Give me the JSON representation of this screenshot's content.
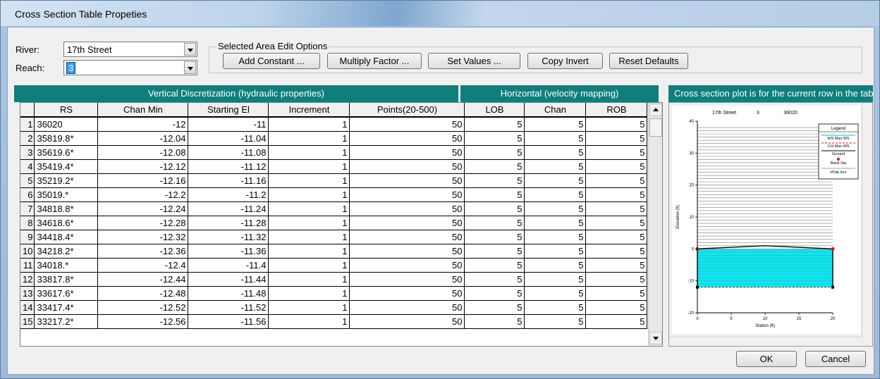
{
  "window": {
    "title": "Cross Section Table Propeties"
  },
  "river": {
    "label": "River:",
    "value": "17th Street"
  },
  "reach": {
    "label": "Reach:",
    "value": "3"
  },
  "edit_options": {
    "legend": "Selected Area Edit Options",
    "add_constant": "Add Constant ...",
    "multiply_factor": "Multiply Factor ...",
    "set_values": "Set Values ...",
    "copy_invert": "Copy Invert",
    "reset_defaults": "Reset Defaults"
  },
  "headers": {
    "vertical": "Vertical Discretization (hydraulic properties)",
    "horizontal": "Horizontal (velocity mapping)",
    "plot": "Cross section plot is for the current row in the table"
  },
  "columns": [
    "RS",
    "Chan Min",
    "Starting El",
    "Increment",
    "Points(20-500)",
    "LOB",
    "Chan",
    "ROB"
  ],
  "rows": [
    [
      "1",
      "36020",
      "-12",
      "-11",
      "1",
      "50",
      "5",
      "5",
      "5"
    ],
    [
      "2",
      "35819.8*",
      "-12.04",
      "-11.04",
      "1",
      "50",
      "5",
      "5",
      "5"
    ],
    [
      "3",
      "35619.6*",
      "-12.08",
      "-11.08",
      "1",
      "50",
      "5",
      "5",
      "5"
    ],
    [
      "4",
      "35419.4*",
      "-12.12",
      "-11.12",
      "1",
      "50",
      "5",
      "5",
      "5"
    ],
    [
      "5",
      "35219.2*",
      "-12.16",
      "-11.16",
      "1",
      "50",
      "5",
      "5",
      "5"
    ],
    [
      "6",
      "35019.*",
      "-12.2",
      "-11.2",
      "1",
      "50",
      "5",
      "5",
      "5"
    ],
    [
      "7",
      "34818.8*",
      "-12.24",
      "-11.24",
      "1",
      "50",
      "5",
      "5",
      "5"
    ],
    [
      "8",
      "34618.6*",
      "-12.28",
      "-11.28",
      "1",
      "50",
      "5",
      "5",
      "5"
    ],
    [
      "9",
      "34418.4*",
      "-12.32",
      "-11.32",
      "1",
      "50",
      "5",
      "5",
      "5"
    ],
    [
      "10",
      "34218.2*",
      "-12.36",
      "-11.36",
      "1",
      "50",
      "5",
      "5",
      "5"
    ],
    [
      "11",
      "34018.*",
      "-12.4",
      "-11.4",
      "1",
      "50",
      "5",
      "5",
      "5"
    ],
    [
      "12",
      "33817.8*",
      "-12.44",
      "-11.44",
      "1",
      "50",
      "5",
      "5",
      "5"
    ],
    [
      "13",
      "33617.6*",
      "-12.48",
      "-11.48",
      "1",
      "50",
      "5",
      "5",
      "5"
    ],
    [
      "14",
      "33417.4*",
      "-12.52",
      "-11.52",
      "1",
      "50",
      "5",
      "5",
      "5"
    ],
    [
      "15",
      "33217.2*",
      "-12.56",
      "-11.56",
      "1",
      "50",
      "5",
      "5",
      "5"
    ]
  ],
  "plot": {
    "title_river": "17th Street",
    "title_reach": "3",
    "title_rs": "36020",
    "ylabel": "Elevation (ft)",
    "xlabel": "Station (ft)",
    "yticks": [
      "40",
      "30",
      "20",
      "10",
      "0",
      "-10",
      "-20"
    ],
    "xticks": [
      "0",
      "5",
      "10",
      "15",
      "20"
    ],
    "legend": {
      "title": "Legend",
      "items": [
        "WS Max WS",
        "Crit Max WS",
        "Ground",
        "Bank Sta",
        "HTab Incr"
      ]
    },
    "colors": {
      "water": "#00e5ee",
      "ground": "#000000",
      "bank": "#ff0000",
      "htab": "#808080"
    }
  },
  "chart_data": {
    "type": "area",
    "title": "17th Street 3 36020",
    "xlabel": "Station (ft)",
    "ylabel": "Elevation (ft)",
    "xlim": [
      0,
      20
    ],
    "ylim": [
      -20,
      40
    ],
    "series": [
      {
        "name": "Ground",
        "x": [
          0,
          0,
          5,
          10,
          15,
          20,
          20
        ],
        "y": [
          -12,
          0,
          0.5,
          1,
          0.5,
          0,
          -12
        ]
      },
      {
        "name": "WS Max WS",
        "x": [
          0,
          20
        ],
        "y": [
          0,
          0
        ]
      },
      {
        "name": "Bank Sta",
        "x": [
          0,
          20
        ],
        "y": [
          0,
          0
        ]
      }
    ],
    "htab_range": [
      -11,
      38
    ]
  },
  "buttons": {
    "ok": "OK",
    "cancel": "Cancel"
  }
}
